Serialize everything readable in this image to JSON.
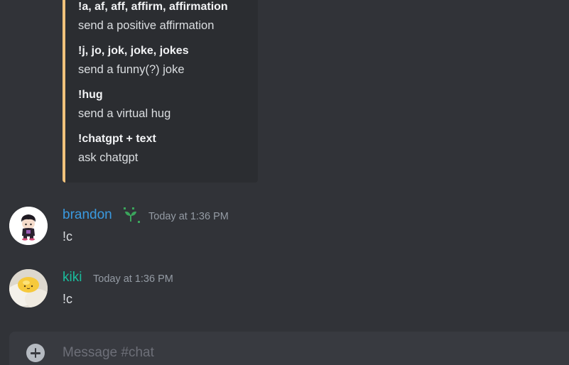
{
  "embed": {
    "accent_color": "#f0c27b",
    "fields": [
      {
        "name": "!a, af, aff, affirm, affirmation",
        "value": "send a positive affirmation"
      },
      {
        "name": "!j, jo, jok, joke, jokes",
        "value": "send a funny(?) joke"
      },
      {
        "name": "!hug",
        "value": "send a virtual hug"
      },
      {
        "name": "!chatgpt + text",
        "value": "ask chatgpt"
      }
    ]
  },
  "messages": [
    {
      "username": "brandon",
      "username_color": "#3a9ae0",
      "timestamp": "Today at 1:36 PM",
      "content": "!c",
      "badge": "sprout-icon"
    },
    {
      "username": "kiki",
      "username_color": "#1abc9c",
      "timestamp": "Today at 1:36 PM",
      "content": "!c"
    }
  ],
  "composer": {
    "placeholder": "Message #chat"
  }
}
